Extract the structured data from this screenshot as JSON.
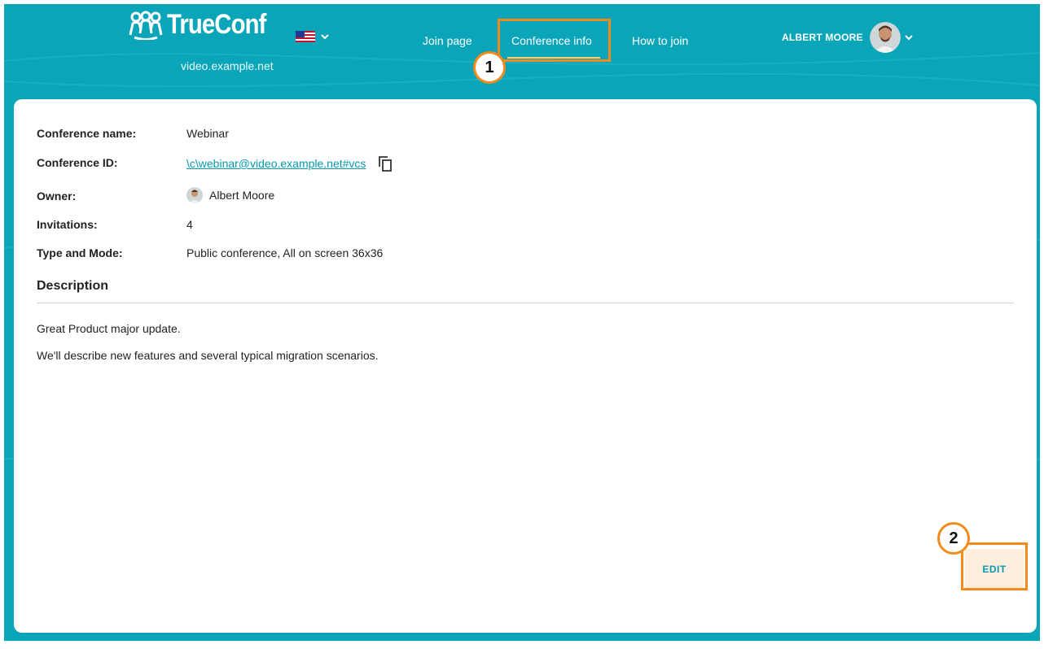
{
  "header": {
    "logo_text": "TrueConf",
    "server": "video.example.net",
    "nav": {
      "join_page": "Join page",
      "conference_info": "Conference info",
      "how_to_join": "How to join"
    },
    "user_name": "ALBERT MOORE"
  },
  "callouts": [
    "1",
    "2"
  ],
  "conference": {
    "name_label": "Conference name:",
    "name": "Webinar",
    "id_label": "Conference ID:",
    "id": "\\c\\webinar@video.example.net#vcs",
    "owner_label": "Owner:",
    "owner": "Albert Moore",
    "invitations_label": "Invitations:",
    "invitations": "4",
    "type_label": "Type and Mode:",
    "type": "Public conference, All on screen 36x36"
  },
  "description": {
    "heading": "Description",
    "lines": [
      "Great Product major update.",
      "We'll describe new features and several typical migration scenarios."
    ]
  },
  "edit_label": "EDIT",
  "colors": {
    "brand": "#0aa5b8",
    "link": "#0a98ad",
    "callout": "#f28a1c"
  }
}
